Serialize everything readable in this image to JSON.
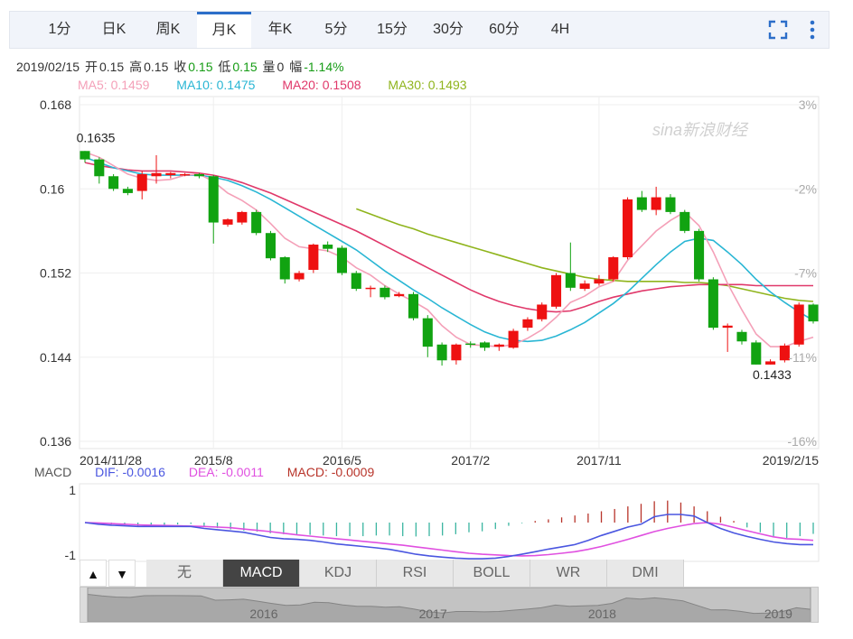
{
  "tabs": [
    {
      "label": "1分",
      "active": false
    },
    {
      "label": "日K",
      "active": false
    },
    {
      "label": "周K",
      "active": false
    },
    {
      "label": "月K",
      "active": true
    },
    {
      "label": "年K",
      "active": false
    },
    {
      "label": "5分",
      "active": false
    },
    {
      "label": "15分",
      "active": false
    },
    {
      "label": "30分",
      "active": false
    },
    {
      "label": "60分",
      "active": false
    },
    {
      "label": "4H",
      "active": false
    }
  ],
  "toolbar": {
    "fullscreen_icon": "fullscreen-icon",
    "more_icon": "more-vertical-icon"
  },
  "info": {
    "date": "2019/02/15",
    "open_label": "开",
    "open": "0.15",
    "high_label": "高",
    "high": "0.15",
    "close_label": "收",
    "close": "0.15",
    "low_label": "低",
    "low": "0.15",
    "volume_label": "量",
    "volume": "0",
    "change_label": "幅",
    "change": "-1.14%"
  },
  "ma": [
    {
      "text": "MA5: 0.1459",
      "color": "#f4a0b8"
    },
    {
      "text": "MA10: 0.1475",
      "color": "#29b6d4"
    },
    {
      "text": "MA20: 0.1508",
      "color": "#e0386a"
    },
    {
      "text": "MA30: 0.1493",
      "color": "#8fb41c"
    }
  ],
  "watermark": "sina新浪财经",
  "colors": {
    "up": "#ee1111",
    "down": "#11a311",
    "ma5": "#f4a0b8",
    "ma10": "#29b6d4",
    "ma20": "#e0386a",
    "ma30": "#8fb41c",
    "dif": "#4a56e0",
    "dea": "#e050e0",
    "hist_up": "#b8342a",
    "hist_down": "#3ab5a0"
  },
  "chart_data": {
    "type": "candlestick",
    "y_ticks": [
      "0.168",
      "0.16",
      "0.152",
      "0.144",
      "0.136"
    ],
    "ylim": [
      0.136,
      0.168
    ],
    "pct_ticks": [
      "3%",
      "-2%",
      "-7%",
      "-11%",
      "-16%"
    ],
    "x_ticks": [
      "2014/11/28",
      "2015/8",
      "2016/5",
      "2017/2",
      "2017/11",
      "2019/2/15"
    ],
    "x_tick_index": [
      0,
      9,
      18,
      27,
      36,
      51
    ],
    "annotations": [
      {
        "text": "0.1635",
        "index": 0,
        "value": 0.1636
      },
      {
        "text": "0.1433",
        "index": 49,
        "value": 0.1433
      }
    ],
    "candles": [
      [
        0.1636,
        0.1628,
        0.1636,
        0.1625
      ],
      [
        0.1628,
        0.1612,
        0.163,
        0.1605
      ],
      [
        0.1612,
        0.16,
        0.1614,
        0.1598
      ],
      [
        0.16,
        0.1596,
        0.1602,
        0.1594
      ],
      [
        0.1598,
        0.1614,
        0.1617,
        0.159
      ],
      [
        0.1612,
        0.1615,
        0.1632,
        0.1605
      ],
      [
        0.1613,
        0.1615,
        0.1616,
        0.161
      ],
      [
        0.1614,
        0.1614,
        0.1615,
        0.1612
      ],
      [
        0.1614,
        0.1612,
        0.1615,
        0.161
      ],
      [
        0.1612,
        0.1568,
        0.1613,
        0.1548
      ],
      [
        0.1566,
        0.1571,
        0.1572,
        0.1564
      ],
      [
        0.1568,
        0.1578,
        0.1579,
        0.1566
      ],
      [
        0.1578,
        0.1558,
        0.158,
        0.1556
      ],
      [
        0.1558,
        0.1534,
        0.156,
        0.1532
      ],
      [
        0.1535,
        0.1514,
        0.1536,
        0.151
      ],
      [
        0.1514,
        0.152,
        0.1522,
        0.1512
      ],
      [
        0.1523,
        0.1547,
        0.1548,
        0.152
      ],
      [
        0.1547,
        0.1543,
        0.155,
        0.154
      ],
      [
        0.1544,
        0.152,
        0.1546,
        0.1518
      ],
      [
        0.152,
        0.1505,
        0.1522,
        0.1503
      ],
      [
        0.1505,
        0.1506,
        0.1508,
        0.1497
      ],
      [
        0.1506,
        0.1497,
        0.1508,
        0.1495
      ],
      [
        0.1498,
        0.15,
        0.1502,
        0.1497
      ],
      [
        0.15,
        0.1477,
        0.1502,
        0.1475
      ],
      [
        0.1477,
        0.145,
        0.148,
        0.144
      ],
      [
        0.1452,
        0.1437,
        0.1454,
        0.1432
      ],
      [
        0.1437,
        0.1452,
        0.1453,
        0.1433
      ],
      [
        0.1453,
        0.1452,
        0.1455,
        0.1449
      ],
      [
        0.1454,
        0.1449,
        0.1455,
        0.1446
      ],
      [
        0.145,
        0.1452,
        0.1453,
        0.1446
      ],
      [
        0.1449,
        0.1465,
        0.1467,
        0.1448
      ],
      [
        0.1468,
        0.1476,
        0.1478,
        0.1465
      ],
      [
        0.1476,
        0.149,
        0.1492,
        0.1474
      ],
      [
        0.1488,
        0.1518,
        0.152,
        0.1486
      ],
      [
        0.152,
        0.1506,
        0.1549,
        0.1503
      ],
      [
        0.1505,
        0.151,
        0.1513,
        0.1503
      ],
      [
        0.151,
        0.1514,
        0.1518,
        0.1508
      ],
      [
        0.1514,
        0.1535,
        0.1536,
        0.1512
      ],
      [
        0.1535,
        0.159,
        0.1592,
        0.1533
      ],
      [
        0.1592,
        0.158,
        0.1598,
        0.1578
      ],
      [
        0.158,
        0.1592,
        0.1602,
        0.1575
      ],
      [
        0.1592,
        0.1578,
        0.1595,
        0.1576
      ],
      [
        0.1578,
        0.156,
        0.158,
        0.1558
      ],
      [
        0.156,
        0.1514,
        0.1562,
        0.1512
      ],
      [
        0.1514,
        0.1468,
        0.1516,
        0.1466
      ],
      [
        0.1468,
        0.147,
        0.1472,
        0.1445
      ],
      [
        0.1464,
        0.1455,
        0.1466,
        0.1452
      ],
      [
        0.1454,
        0.1433,
        0.1456,
        0.1433
      ],
      [
        0.1433,
        0.1436,
        0.1438,
        0.1433
      ],
      [
        0.1437,
        0.1451,
        0.1453,
        0.1435
      ],
      [
        0.1452,
        0.149,
        0.1492,
        0.145
      ],
      [
        0.149,
        0.1474,
        0.1491,
        0.1472
      ]
    ],
    "ma5": [
      0.1635,
      0.163,
      0.1622,
      0.1614,
      0.161,
      0.1608,
      0.1609,
      0.1613,
      0.1614,
      0.1607,
      0.1596,
      0.1589,
      0.158,
      0.1567,
      0.1553,
      0.1545,
      0.1543,
      0.1541,
      0.1535,
      0.1525,
      0.1518,
      0.1508,
      0.15,
      0.1493,
      0.1485,
      0.147,
      0.1459,
      0.1452,
      0.1451,
      0.145,
      0.1452,
      0.1458,
      0.1466,
      0.1478,
      0.1492,
      0.1498,
      0.1507,
      0.1512,
      0.1532,
      0.1546,
      0.156,
      0.157,
      0.1578,
      0.1565,
      0.154,
      0.151,
      0.1485,
      0.1462,
      0.145,
      0.145,
      0.1455,
      0.1459
    ],
    "ma10": [
      0.163,
      0.1625,
      0.162,
      0.1617,
      0.1614,
      0.1613,
      0.1613,
      0.1613,
      0.1613,
      0.1611,
      0.1608,
      0.1603,
      0.1597,
      0.159,
      0.1582,
      0.1574,
      0.1566,
      0.1558,
      0.155,
      0.1542,
      0.1532,
      0.1522,
      0.1513,
      0.1504,
      0.1496,
      0.1487,
      0.1479,
      0.1471,
      0.1464,
      0.1459,
      0.1456,
      0.1455,
      0.1456,
      0.146,
      0.1466,
      0.1473,
      0.1482,
      0.1491,
      0.1502,
      0.1515,
      0.1528,
      0.154,
      0.155,
      0.1553,
      0.1551,
      0.154,
      0.1528,
      0.1514,
      0.1502,
      0.1492,
      0.1483,
      0.1475
    ],
    "ma20": [
      0.1625,
      0.1622,
      0.162,
      0.1618,
      0.1617,
      0.1617,
      0.1617,
      0.1616,
      0.1615,
      0.1613,
      0.161,
      0.1606,
      0.1601,
      0.1596,
      0.159,
      0.1584,
      0.1578,
      0.1572,
      0.1566,
      0.156,
      0.1553,
      0.1546,
      0.1539,
      0.1532,
      0.1525,
      0.1518,
      0.1511,
      0.1504,
      0.1498,
      0.1493,
      0.1489,
      0.1486,
      0.1484,
      0.1483,
      0.1484,
      0.1488,
      0.1493,
      0.1497,
      0.15,
      0.1503,
      0.1505,
      0.1507,
      0.1508,
      0.1509,
      0.1509,
      0.1509,
      0.1509,
      0.1508,
      0.1508,
      0.1508,
      0.1508,
      0.1508
    ],
    "ma30": [
      null,
      null,
      null,
      null,
      null,
      null,
      null,
      null,
      null,
      null,
      null,
      null,
      null,
      null,
      null,
      null,
      null,
      null,
      null,
      0.1581,
      0.1576,
      0.1571,
      0.1566,
      0.1562,
      0.1557,
      0.1553,
      0.1549,
      0.1545,
      0.1541,
      0.1537,
      0.1533,
      0.1529,
      0.1525,
      0.1522,
      0.1519,
      0.1516,
      0.1514,
      0.1513,
      0.1512,
      0.1512,
      0.1512,
      0.1512,
      0.1511,
      0.1511,
      0.151,
      0.1508,
      0.1505,
      0.1502,
      0.1499,
      0.1496,
      0.1494,
      0.1493
    ],
    "macd": {
      "labels": [
        "MACD",
        "DIF: -0.0016",
        "DEA: -0.0011",
        "MACD: -0.0009"
      ],
      "y_ticks": [
        "1",
        "-1"
      ],
      "ylim": [
        -1.2,
        1.2
      ],
      "dif": [
        0.0,
        -0.05,
        -0.08,
        -0.1,
        -0.12,
        -0.12,
        -0.12,
        -0.12,
        -0.12,
        -0.18,
        -0.22,
        -0.26,
        -0.3,
        -0.38,
        -0.46,
        -0.5,
        -0.52,
        -0.55,
        -0.6,
        -0.66,
        -0.7,
        -0.74,
        -0.78,
        -0.83,
        -0.9,
        -0.98,
        -1.03,
        -1.07,
        -1.1,
        -1.12,
        -1.12,
        -1.1,
        -1.05,
        -0.98,
        -0.9,
        -0.82,
        -0.75,
        -0.68,
        -0.55,
        -0.4,
        -0.27,
        -0.14,
        -0.05,
        0.18,
        0.25,
        0.25,
        0.2,
        0.0,
        -0.18,
        -0.32,
        -0.43,
        -0.52,
        -0.6,
        -0.65,
        -0.68,
        -0.68
      ],
      "dea": [
        0.0,
        -0.01,
        -0.03,
        -0.05,
        -0.07,
        -0.08,
        -0.09,
        -0.1,
        -0.11,
        -0.12,
        -0.14,
        -0.16,
        -0.2,
        -0.24,
        -0.28,
        -0.33,
        -0.38,
        -0.42,
        -0.46,
        -0.5,
        -0.54,
        -0.58,
        -0.62,
        -0.66,
        -0.7,
        -0.75,
        -0.8,
        -0.85,
        -0.9,
        -0.95,
        -0.98,
        -1.0,
        -1.02,
        -1.03,
        -1.02,
        -0.99,
        -0.95,
        -0.9,
        -0.83,
        -0.74,
        -0.63,
        -0.52,
        -0.4,
        -0.28,
        -0.18,
        -0.1,
        -0.03,
        0.0,
        -0.05,
        -0.15,
        -0.25,
        -0.35,
        -0.44,
        -0.5,
        -0.52,
        -0.55
      ],
      "hist": [
        0,
        -0.05,
        -0.06,
        -0.08,
        -0.1,
        -0.09,
        -0.08,
        -0.06,
        -0.04,
        -0.12,
        -0.17,
        -0.21,
        -0.25,
        -0.28,
        -0.33,
        -0.36,
        -0.38,
        -0.38,
        -0.4,
        -0.42,
        -0.42,
        -0.42,
        -0.4,
        -0.4,
        -0.42,
        -0.43,
        -0.42,
        -0.4,
        -0.36,
        -0.3,
        -0.27,
        -0.2,
        -0.1,
        -0.02,
        0.05,
        0.1,
        0.16,
        0.22,
        0.28,
        0.35,
        0.42,
        0.5,
        0.58,
        0.66,
        0.68,
        0.62,
        0.5,
        0.35,
        0.18,
        0.05,
        -0.15,
        -0.3,
        -0.45,
        -0.48,
        -0.42,
        -0.35
      ]
    }
  },
  "indicators": {
    "up_arrow": "▲",
    "down_arrow": "▼",
    "items": [
      {
        "label": "无",
        "active": false
      },
      {
        "label": "MACD",
        "active": true
      },
      {
        "label": "KDJ",
        "active": false
      },
      {
        "label": "RSI",
        "active": false
      },
      {
        "label": "BOLL",
        "active": false
      },
      {
        "label": "WR",
        "active": false
      },
      {
        "label": "DMI",
        "active": false
      }
    ]
  },
  "navigator": {
    "years": [
      "2016",
      "2017",
      "2018",
      "2019"
    ],
    "years_at": [
      0.25,
      0.49,
      0.73,
      0.98
    ]
  }
}
